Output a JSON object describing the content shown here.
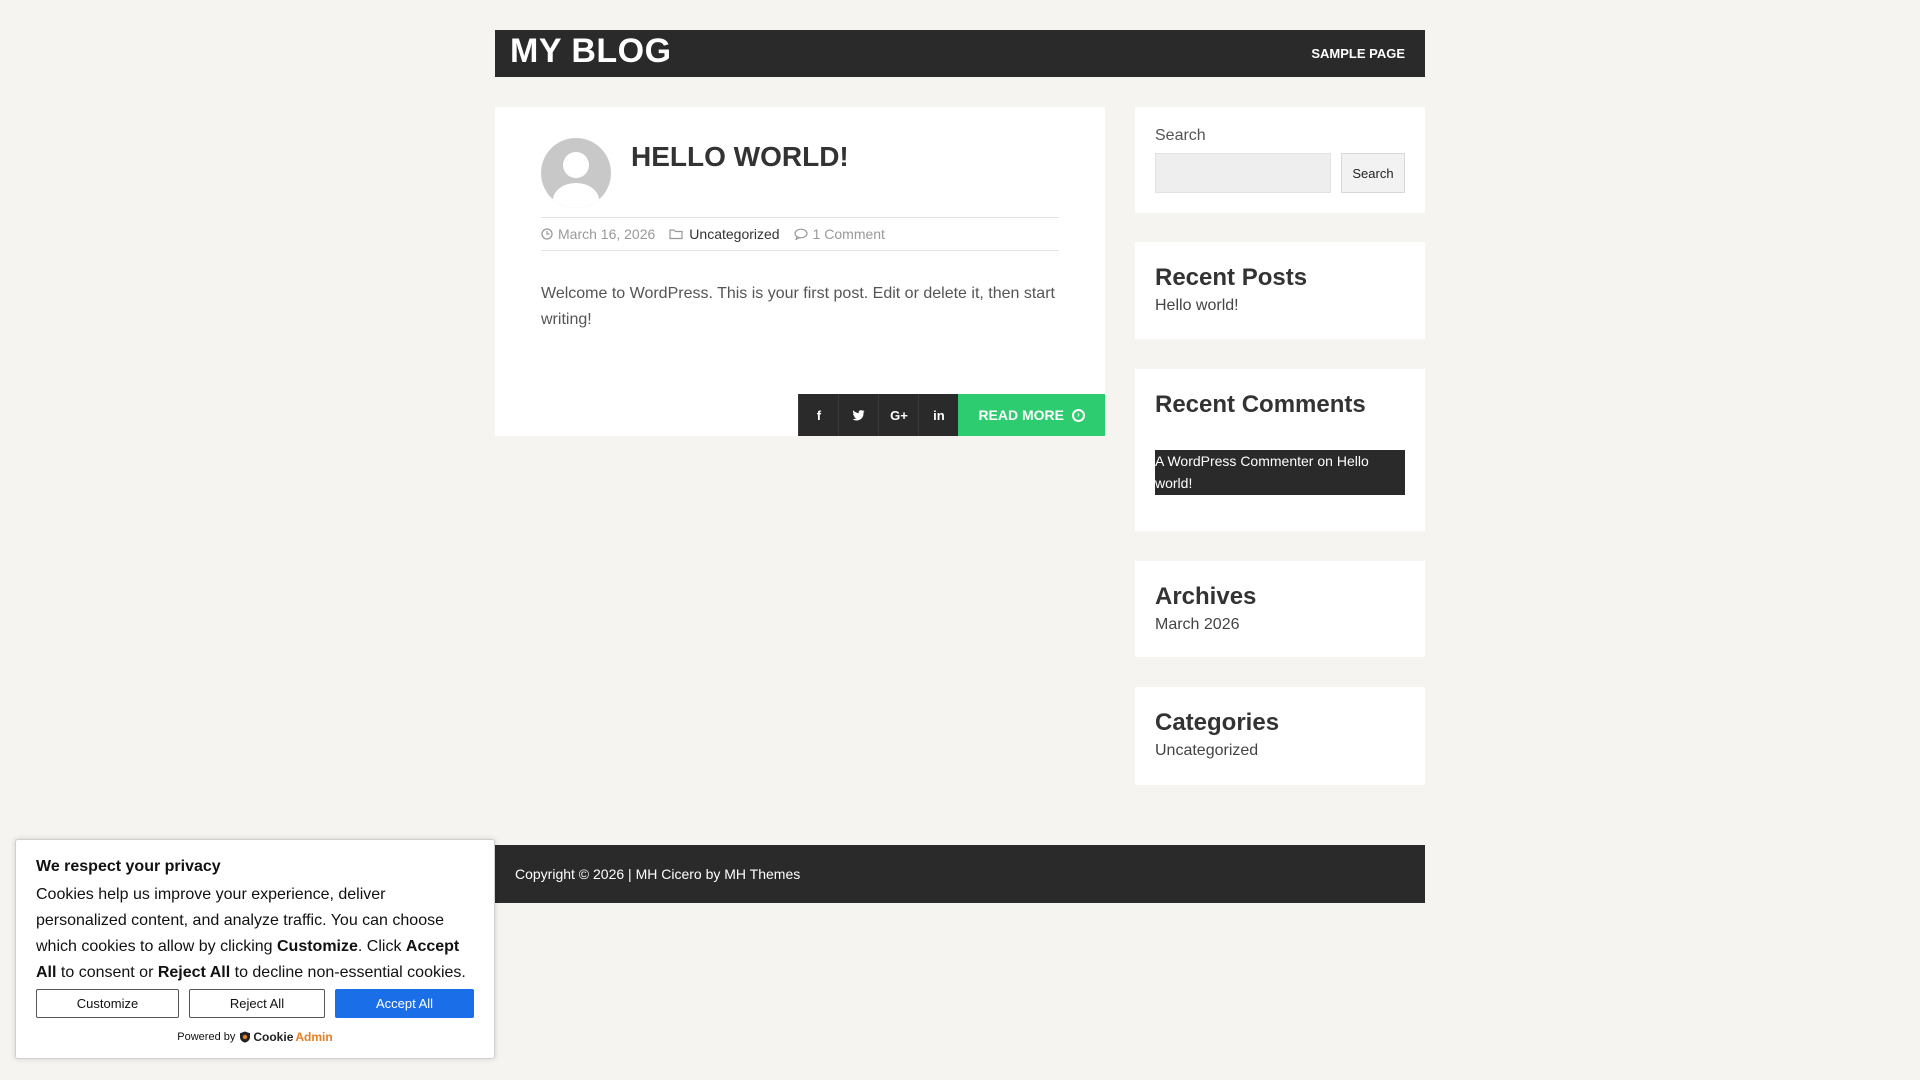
{
  "header": {
    "site_title": "MY BLOG",
    "nav": [
      "SAMPLE PAGE"
    ]
  },
  "post": {
    "title": "HELLO WORLD!",
    "date": "March 16, 2026",
    "category": "Uncategorized",
    "comments": "1 Comment",
    "excerpt": "Welcome to WordPress. This is your first post. Edit or delete it, then start writing!",
    "share_icons": [
      "facebook-icon",
      "twitter-icon",
      "google-plus-icon",
      "linkedin-icon"
    ],
    "read_more": "READ MORE"
  },
  "sidebar": {
    "search": {
      "label": "Search",
      "button": "Search",
      "placeholder": ""
    },
    "recent_posts": {
      "title": "Recent Posts",
      "items": [
        "Hello world!"
      ]
    },
    "recent_comments": {
      "title": "Recent Comments",
      "author": "A WordPress Commenter",
      "on": "on",
      "post": "Hello world!"
    },
    "archives": {
      "title": "Archives",
      "items": [
        "March 2026"
      ]
    },
    "categories": {
      "title": "Categories",
      "items": [
        "Uncategorized"
      ]
    }
  },
  "footer": {
    "copyright": "Copyright © 2026 | MH Cicero by MH Themes"
  },
  "cookie": {
    "title": "We respect your privacy",
    "text_1": "Cookies help us improve your experience, deliver personalized content, and analyze traffic. You can choose which cookies to allow by clicking ",
    "bold_customize": "Customize",
    "text_2": ". Click ",
    "bold_accept": "Accept All",
    "text_3": " to consent or ",
    "bold_reject": "Reject All",
    "text_4": " to decline non-essential cookies.",
    "btn_customize": "Customize",
    "btn_reject": "Reject All",
    "btn_accept": "Accept All",
    "powered_by": "Powered by",
    "brand_part1": "Cookie",
    "brand_part2": "Admin",
    "accent_color": "#1a6ee8"
  },
  "colors": {
    "dark": "#2a2a2a",
    "green": "#2ecc71",
    "background": "#f5f4f0"
  }
}
